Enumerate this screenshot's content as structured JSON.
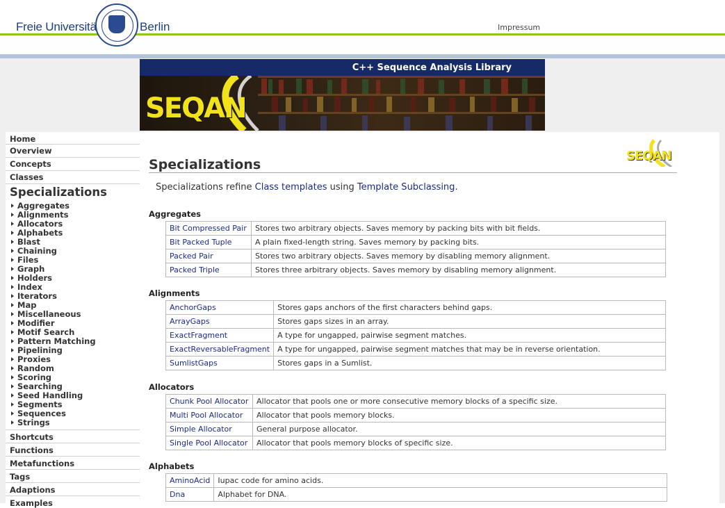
{
  "header": {
    "university_left": "Freie Universität",
    "university_right": "Berlin",
    "impressum": "Impressum",
    "banner_title": "C++ Sequence Analysis Library",
    "logo_text": "SEQAN"
  },
  "sidebar": {
    "top_links": [
      "Home",
      "Overview",
      "Concepts",
      "Classes"
    ],
    "active_section": "Specializations",
    "sub_items": [
      "Aggregates",
      "Alignments",
      "Allocators",
      "Alphabets",
      "Blast",
      "Chaining",
      "Files",
      "Graph",
      "Holders",
      "Index",
      "Iterators",
      "Map",
      "Miscellaneous",
      "Modifier",
      "Motif Search",
      "Pattern Matching",
      "Pipelining",
      "Proxies",
      "Random",
      "Scoring",
      "Searching",
      "Seed Handling",
      "Segments",
      "Sequences",
      "Strings"
    ],
    "bottom_links": [
      "Shortcuts",
      "Functions",
      "Metafunctions",
      "Tags",
      "Adaptions",
      "Examples"
    ]
  },
  "main": {
    "title": "Specializations",
    "intro_prefix": "Specializations refine ",
    "intro_link1": "Class templates",
    "intro_middle": " using ",
    "intro_link2": "Template Subclassing",
    "intro_suffix": ".",
    "sections": [
      {
        "heading": "Aggregates",
        "rows": [
          {
            "name": "Bit Compressed Pair",
            "desc": "Stores two arbitrary objects. Saves memory by packing bits with bit fields."
          },
          {
            "name": "Bit Packed Tuple",
            "desc": "A plain fixed-length string. Saves memory by packing bits."
          },
          {
            "name": "Packed Pair",
            "desc": "Stores two arbitrary objects. Saves memory by disabling memory alignment."
          },
          {
            "name": "Packed Triple",
            "desc": "Stores three arbitrary objects. Saves memory by disabling memory alignment."
          }
        ]
      },
      {
        "heading": "Alignments",
        "rows": [
          {
            "name": "AnchorGaps",
            "desc": "Stores gaps anchors of the first characters behind gaps."
          },
          {
            "name": "ArrayGaps",
            "desc": "Stores gaps sizes in an array."
          },
          {
            "name": "ExactFragment",
            "desc": "A type for ungapped, pairwise segment matches."
          },
          {
            "name": "ExactReversableFragment",
            "desc": "A type for ungapped, pairwise segment matches that may be in reverse orientation."
          },
          {
            "name": "SumlistGaps",
            "desc": "Stores gaps in a Sumlist."
          }
        ]
      },
      {
        "heading": "Allocators",
        "rows": [
          {
            "name": "Chunk Pool Allocator",
            "desc": "Allocator that pools one or more consecutive memory blocks of a specific size."
          },
          {
            "name": "Multi Pool Allocator",
            "desc": "Allocator that pools memory blocks."
          },
          {
            "name": "Simple Allocator",
            "desc": "General purpose allocator."
          },
          {
            "name": "Single Pool Allocator",
            "desc": "Allocator that pools memory blocks of specific size."
          }
        ]
      },
      {
        "heading": "Alphabets",
        "rows": [
          {
            "name": "AminoAcid",
            "desc": "Iupac code for amino acids."
          },
          {
            "name": "Dna",
            "desc": "Alphabet for DNA."
          }
        ]
      }
    ]
  },
  "colors": {
    "link": "#1a2a8c",
    "banner_bg": "#152a66",
    "green_rule": "#8fc31f",
    "blue_rule": "#b4c3dc",
    "logo_yellow": "#f2e21a"
  }
}
